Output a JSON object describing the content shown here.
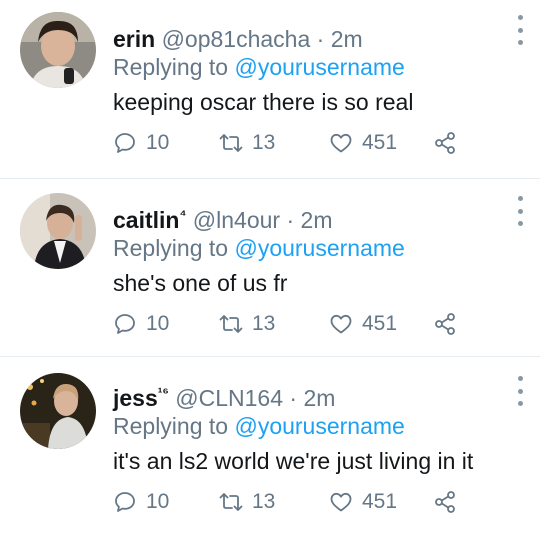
{
  "tweets": [
    {
      "name": "erin",
      "badge": "",
      "handle": "@op81chacha",
      "sep": "·",
      "time": "2m",
      "reply_prefix": "Replying to",
      "reply_to": "@yourusername",
      "text": "keeping oscar there is so real",
      "replies": "10",
      "retweets": "13",
      "likes": "451"
    },
    {
      "name": "caitlin",
      "badge": "⁴",
      "handle": "@ln4our",
      "sep": "·",
      "time": "2m",
      "reply_prefix": "Replying to",
      "reply_to": "@yourusername",
      "text": "she's one of us fr",
      "replies": "10",
      "retweets": "13",
      "likes": "451"
    },
    {
      "name": "jess",
      "badge": "¹⁶",
      "handle": "@CLN164",
      "sep": "·",
      "time": "2m",
      "reply_prefix": "Replying to",
      "reply_to": "@yourusername",
      "text": "it's an ls2 world we're just living in it",
      "replies": "10",
      "retweets": "13",
      "likes": "451"
    }
  ],
  "colors": {
    "text": "#14171a",
    "muted": "#657786",
    "mention": "#1da1f2",
    "divider": "#e6ecf0"
  },
  "icons": [
    "reply-icon",
    "retweet-icon",
    "like-icon",
    "share-icon",
    "more-options-icon"
  ]
}
